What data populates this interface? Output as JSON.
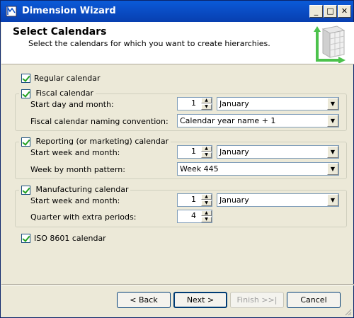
{
  "window": {
    "title": "Dimension Wizard"
  },
  "titlebar_controls": {
    "minimize": "_",
    "maximize": "□",
    "close": "✕"
  },
  "header": {
    "title": "Select Calendars",
    "subtitle": "Select the calendars for which you want to create hierarchies."
  },
  "regular": {
    "label": "Regular calendar",
    "checked": true
  },
  "fiscal": {
    "label": "Fiscal calendar",
    "checked": true,
    "start_label": "Start day and month:",
    "start_day": "1",
    "start_month": "January",
    "naming_label": "Fiscal calendar naming convention:",
    "naming_value": "Calendar year name + 1"
  },
  "reporting": {
    "label": "Reporting (or marketing) calendar",
    "checked": true,
    "start_label": "Start week and month:",
    "start_week": "1",
    "start_month": "January",
    "pattern_label": "Week by month pattern:",
    "pattern_value": "Week 445"
  },
  "manufacturing": {
    "label": "Manufacturing calendar",
    "checked": true,
    "start_label": "Start week and month:",
    "start_week": "1",
    "start_month": "January",
    "quarter_label": "Quarter with extra periods:",
    "quarter_value": "4"
  },
  "iso": {
    "label": "ISO 8601 calendar",
    "checked": true
  },
  "buttons": {
    "back": "< Back",
    "next": "Next >",
    "finish": "Finish >>|",
    "cancel": "Cancel"
  }
}
